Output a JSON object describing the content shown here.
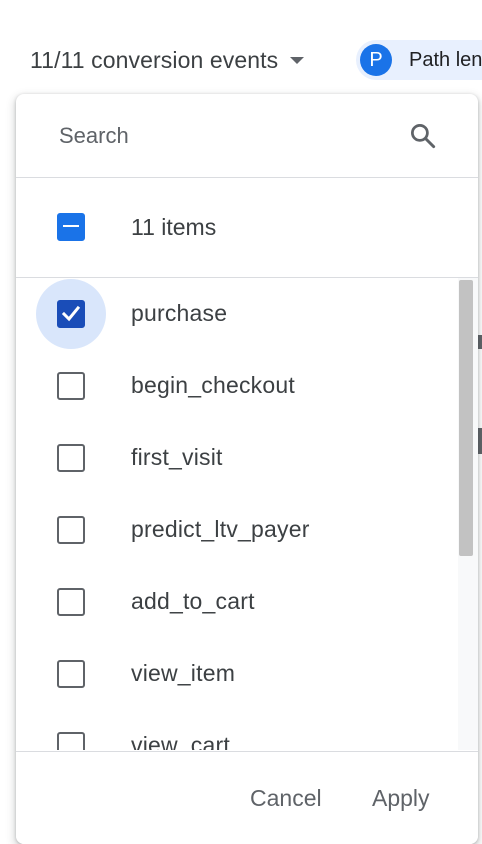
{
  "header": {
    "events_dropdown_label": "11/11 conversion events",
    "chip": {
      "avatar_letter": "P",
      "label": "Path len"
    }
  },
  "panel": {
    "search": {
      "placeholder": "Search",
      "value": ""
    },
    "select_all": {
      "label": "11 items",
      "state": "indeterminate"
    },
    "items": [
      {
        "label": "purchase",
        "checked": true
      },
      {
        "label": "begin_checkout",
        "checked": false
      },
      {
        "label": "first_visit",
        "checked": false
      },
      {
        "label": "predict_ltv_payer",
        "checked": false
      },
      {
        "label": "add_to_cart",
        "checked": false
      },
      {
        "label": "view_item",
        "checked": false
      },
      {
        "label": "view_cart",
        "checked": false
      }
    ],
    "footer": {
      "cancel_label": "Cancel",
      "apply_label": "Apply"
    }
  },
  "colors": {
    "accent": "#1a73e8",
    "checked_box": "#1a4db8",
    "chip_background": "#e8f0fe",
    "text": "#3c4043"
  },
  "icons": {
    "search": "search-icon",
    "dropdown_caret": "caret-down-icon",
    "checkmark": "checkmark-icon"
  }
}
